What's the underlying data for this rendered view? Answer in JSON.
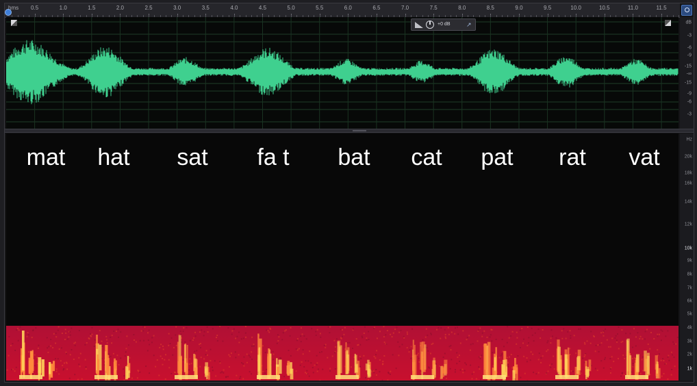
{
  "ruler": {
    "unit_label": "hms",
    "ticks": [
      "0.5",
      "1.0",
      "1.5",
      "2.0",
      "2.5",
      "3.0",
      "3.5",
      "4.0",
      "4.5",
      "5.0",
      "5.5",
      "6.0",
      "6.5",
      "7.0",
      "7.5",
      "8.0",
      "8.5",
      "9.0",
      "9.5",
      "10.0",
      "10.5",
      "11.0",
      "11.5"
    ],
    "start_seconds": 0,
    "end_seconds": 11.8
  },
  "hud": {
    "volume_value": "+0 dB"
  },
  "db_scale": {
    "unit": "dB",
    "labels": [
      "-3",
      "-6",
      "-9",
      "-15",
      "-∞",
      "-15",
      "-9",
      "-6",
      "-3"
    ]
  },
  "hz_scale": {
    "unit": "Hz",
    "labels": [
      "20k",
      "18k",
      "16k",
      "14k",
      "12k",
      "10k",
      "9k",
      "8k",
      "7k",
      "6k",
      "5k",
      "4k",
      "3k",
      "2k",
      "1k"
    ],
    "strong_labels": [
      "10k",
      "1k"
    ]
  },
  "spoken_words": [
    "mat",
    "hat",
    "sat",
    "fa t",
    "bat",
    "cat",
    "pat",
    "rat",
    "vat"
  ],
  "colors": {
    "waveform": "#3fd08f",
    "background": "#070908",
    "grid": "#1e4a2e",
    "spectrogram_low": "#c8102e",
    "spectrogram_high": "#ffe27a",
    "accent": "#3f7fd8"
  },
  "icons": {
    "playhead": "playhead-handle-icon",
    "zoom": "zoom-lens-icon",
    "hud_volume": "volume-wedge-icon",
    "hud_knob": "volume-knob-icon",
    "hud_pin": "pin-icon"
  }
}
